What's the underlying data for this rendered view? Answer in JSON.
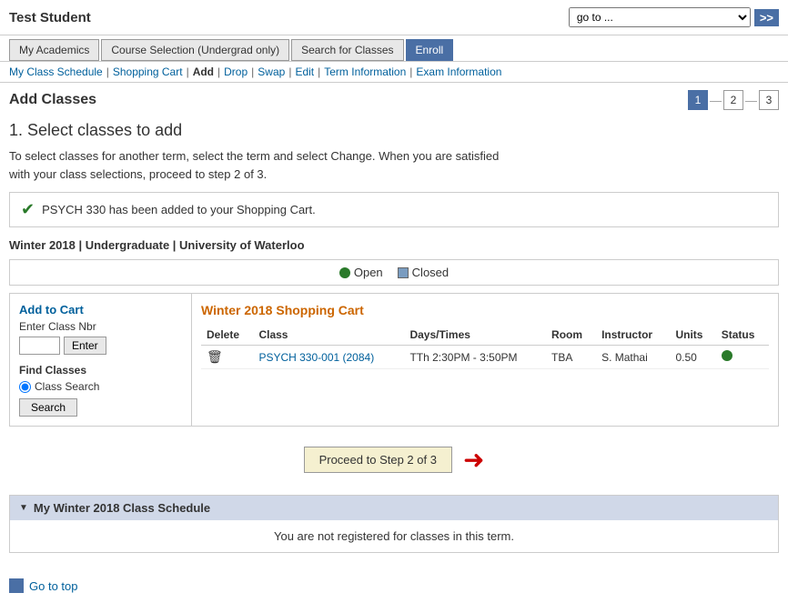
{
  "header": {
    "title": "Test Student",
    "goto": {
      "label": "go to ...",
      "placeholder": "go to ...",
      "btn_label": ">>"
    }
  },
  "nav": {
    "tabs": [
      {
        "label": "My Academics",
        "active": false
      },
      {
        "label": "Course Selection (Undergrad only)",
        "active": false
      },
      {
        "label": "Search for Classes",
        "active": false
      },
      {
        "label": "Enroll",
        "active": true
      }
    ]
  },
  "subnav": {
    "links": [
      {
        "label": "My Class Schedule",
        "active": false
      },
      {
        "label": "Shopping Cart",
        "active": false
      },
      {
        "label": "Add",
        "active": true
      },
      {
        "label": "Drop",
        "active": false
      },
      {
        "label": "Swap",
        "active": false
      },
      {
        "label": "Edit",
        "active": false
      },
      {
        "label": "Term Information",
        "active": false
      },
      {
        "label": "Exam Information",
        "active": false
      }
    ]
  },
  "page": {
    "title": "Add Classes",
    "steps": [
      "1",
      "2",
      "3"
    ],
    "active_step": 0
  },
  "section1": {
    "title": "1.  Select classes to add",
    "description": "To select classes for another term, select the term and select Change.  When you are satisfied\nwith your class selections, proceed to step 2 of 3."
  },
  "success": {
    "message": "PSYCH  330 has been added to your Shopping Cart."
  },
  "term": {
    "info": "Winter 2018 | Undergraduate | University of Waterloo"
  },
  "legend": {
    "open_label": "Open",
    "closed_label": "Closed"
  },
  "add_to_cart": {
    "title": "Add to Cart",
    "enter_class_nbr_label": "Enter Class Nbr",
    "enter_btn_label": "Enter",
    "find_classes_label": "Find Classes",
    "class_search_label": "Class Search",
    "search_btn_label": "Search"
  },
  "shopping_cart": {
    "title": "Winter 2018 Shopping Cart",
    "columns": [
      "Delete",
      "Class",
      "Days/Times",
      "Room",
      "Instructor",
      "Units",
      "Status"
    ],
    "rows": [
      {
        "class": "PSYCH 330-001 (2084)",
        "days_times": "TTh 2:30PM - 3:50PM",
        "room": "TBA",
        "instructor": "S. Mathai",
        "units": "0.50",
        "status": "open"
      }
    ]
  },
  "proceed": {
    "btn_label": "Proceed to Step 2 of 3"
  },
  "schedule": {
    "title": "My Winter 2018 Class Schedule",
    "empty_msg": "You are not registered for classes in this term."
  },
  "footer": {
    "goto_top_label": "Go to top"
  }
}
